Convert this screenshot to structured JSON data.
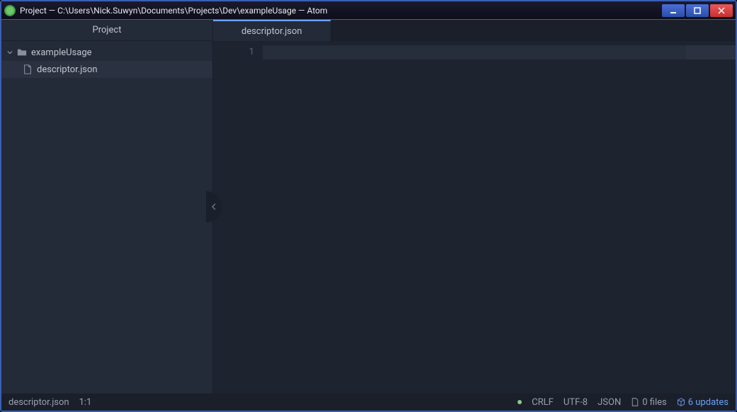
{
  "window": {
    "title": "Project — C:\\Users\\Nick.Suwyn\\Documents\\Projects\\Dev\\exampleUsage — Atom"
  },
  "sidebar": {
    "header": "Project",
    "root": {
      "name": "exampleUsage",
      "expanded": true,
      "children": [
        {
          "name": "descriptor.json",
          "selected": true
        }
      ]
    }
  },
  "tabs": [
    {
      "label": "descriptor.json",
      "active": true
    }
  ],
  "editor": {
    "lines": [
      "1"
    ],
    "content": [
      ""
    ]
  },
  "statusbar": {
    "filename": "descriptor.json",
    "cursor": "1:1",
    "line_ending": "CRLF",
    "encoding": "UTF-8",
    "language": "JSON",
    "files": "0 files",
    "updates": "6 updates"
  }
}
